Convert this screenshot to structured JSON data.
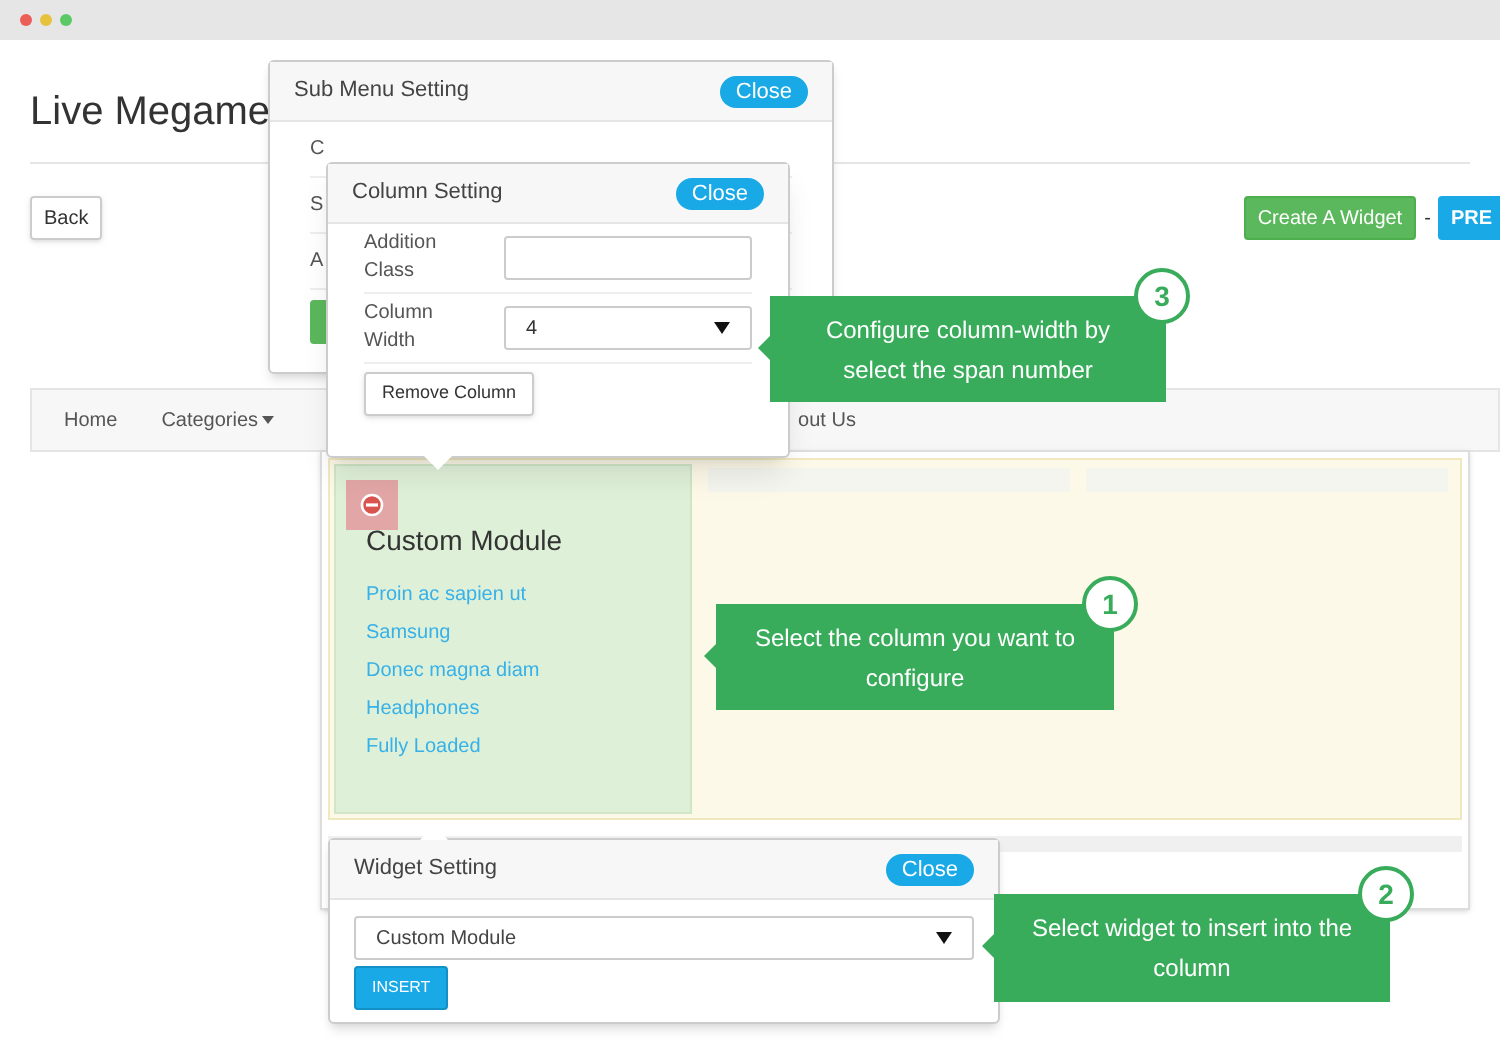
{
  "page": {
    "title": "Live Megame",
    "back_button": "Back",
    "create_button": "Create A Widget",
    "separator": "-",
    "preview_button": "PRE"
  },
  "nav": {
    "items": [
      {
        "label": "Home",
        "dropdown": false
      },
      {
        "label": "Categories",
        "dropdown": true
      }
    ],
    "trailing_item": "out Us"
  },
  "module": {
    "title": "Custom Module",
    "links": [
      "Proin ac sapien ut",
      "Samsung",
      "Donec magna diam",
      "Headphones",
      "Fully Loaded"
    ]
  },
  "sub_menu_setting": {
    "title": "Sub Menu Setting",
    "close": "Close",
    "row_labels": [
      "C",
      "S",
      "A"
    ]
  },
  "column_setting": {
    "title": "Column Setting",
    "close": "Close",
    "fields": [
      {
        "kind": "input",
        "label": "Addition Class"
      },
      {
        "kind": "select",
        "label": "Column Width",
        "value": "4"
      }
    ],
    "remove_button": "Remove Column"
  },
  "widget_setting": {
    "title": "Widget Setting",
    "close": "Close",
    "selected_widget": "Custom Module",
    "insert_button": "INSERT"
  },
  "callouts": [
    {
      "number": "3",
      "text": "Configure column-width by select the span number"
    },
    {
      "number": "1",
      "text": "Select the column you want to configure"
    },
    {
      "number": "2",
      "text": "Select widget to insert into the column"
    }
  ]
}
